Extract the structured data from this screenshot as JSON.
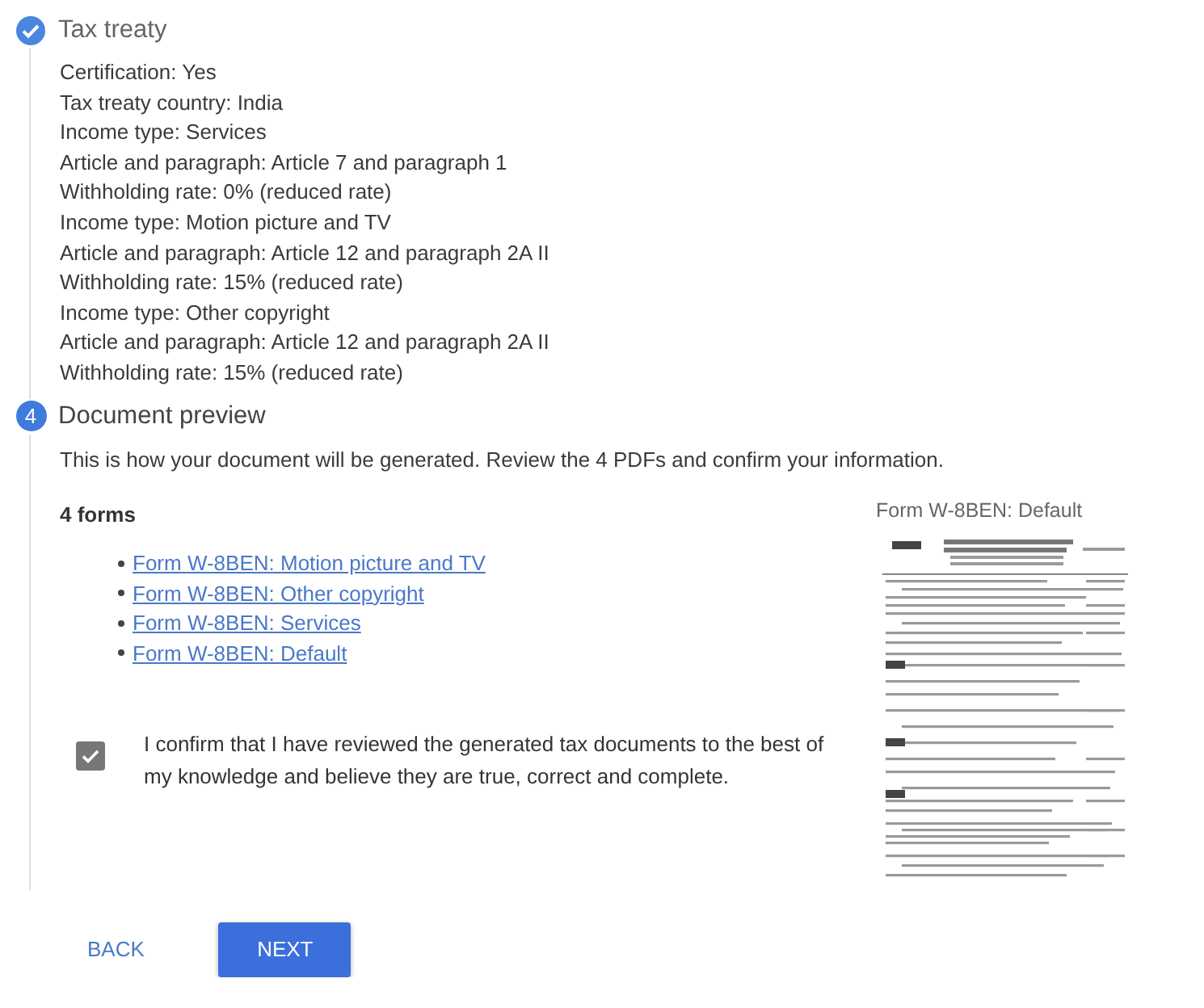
{
  "steps": [
    {
      "kind": "done",
      "title": "Tax treaty",
      "lines": [
        "Certification: Yes",
        "Tax treaty country: India",
        "Income type: Services",
        "Article and paragraph: Article 7 and paragraph 1",
        "Withholding rate: 0% (reduced rate)",
        "Income type: Motion picture and TV",
        "Article and paragraph: Article 12 and paragraph 2A II",
        "Withholding rate: 15% (reduced rate)",
        "Income type: Other copyright",
        "Article and paragraph: Article 12 and paragraph 2A II",
        "Withholding rate: 15% (reduced rate)"
      ]
    },
    {
      "kind": "active",
      "number": "4",
      "title": "Document preview",
      "intro": "This is how your document will be generated. Review the 4 PDFs and confirm your information.",
      "forms_heading": "4 forms",
      "forms": [
        "Form W-8BEN: Motion picture and TV",
        "Form W-8BEN: Other copyright",
        "Form W-8BEN: Services",
        "Form W-8BEN: Default"
      ],
      "preview_title": "Form W-8BEN: Default",
      "confirm": {
        "checked": true,
        "label": "I confirm that I have reviewed the generated tax documents to the best of my knowledge and believe they are true, correct and complete."
      }
    }
  ],
  "buttons": [
    {
      "kind": "text",
      "label": "BACK"
    },
    {
      "kind": "primary",
      "label": "NEXT"
    }
  ]
}
